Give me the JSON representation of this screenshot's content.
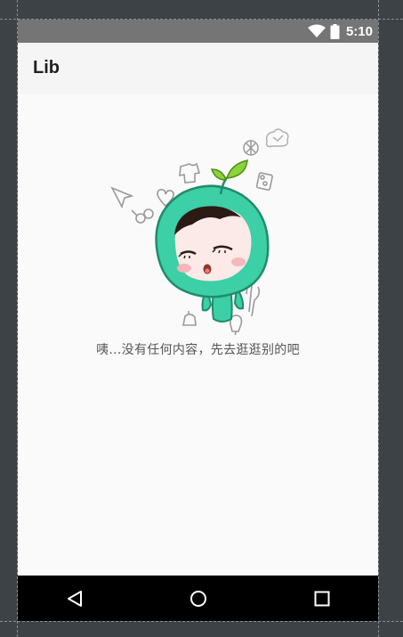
{
  "status_bar": {
    "time": "5:10",
    "icons": [
      "wifi-icon",
      "battery-icon"
    ],
    "background": "#757575"
  },
  "app_bar": {
    "title": "Lib",
    "background": "#f5f5f5"
  },
  "empty_state": {
    "illustration": "sleeping-sprout-mascot",
    "message": "咦...没有任何内容，先去逛逛别的吧"
  },
  "nav_bar": {
    "buttons": [
      "back-icon",
      "home-icon",
      "recents-icon"
    ]
  },
  "colors": {
    "mascot_green": "#3dcfa5",
    "leaf_green": "#8bd33a",
    "nav_background": "#000000"
  }
}
